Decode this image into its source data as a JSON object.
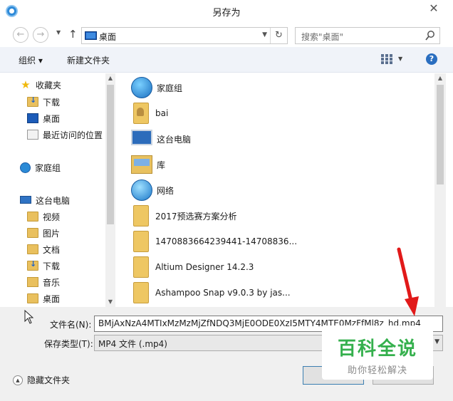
{
  "window": {
    "title": "另存为",
    "close": "✕"
  },
  "nav": {
    "back": "←",
    "forward": "→",
    "up": "↑",
    "address": "桌面",
    "search_placeholder": "搜索\"桌面\""
  },
  "toolbar": {
    "organize": "组织 ▾",
    "new_folder": "新建文件夹",
    "help": "?"
  },
  "sidebar": {
    "items": [
      {
        "label": "收藏夹",
        "icon": "star-icon"
      },
      {
        "label": "下载",
        "icon": "download-folder-icon"
      },
      {
        "label": "桌面",
        "icon": "desktop-icon"
      },
      {
        "label": "最近访问的位置",
        "icon": "recent-places-icon"
      },
      {
        "label": "家庭组",
        "icon": "homegroup-icon"
      },
      {
        "label": "这台电脑",
        "icon": "computer-icon"
      },
      {
        "label": "视频",
        "icon": "videos-folder-icon"
      },
      {
        "label": "图片",
        "icon": "pictures-folder-icon"
      },
      {
        "label": "文档",
        "icon": "documents-folder-icon"
      },
      {
        "label": "下载",
        "icon": "download-folder-icon"
      },
      {
        "label": "音乐",
        "icon": "music-folder-icon"
      },
      {
        "label": "桌面",
        "icon": "desktop-folder-icon"
      }
    ]
  },
  "files": [
    {
      "name": "家庭组",
      "icon": "homegroup-icon"
    },
    {
      "name": "bai",
      "icon": "user-folder-icon"
    },
    {
      "name": "这台电脑",
      "icon": "computer-icon"
    },
    {
      "name": "库",
      "icon": "libraries-icon"
    },
    {
      "name": "网络",
      "icon": "network-icon"
    },
    {
      "name": "2017预选赛方案分析",
      "icon": "folder-icon"
    },
    {
      "name": "1470883664239441-14708836...",
      "icon": "folder-icon"
    },
    {
      "name": "Altium Designer 14.2.3",
      "icon": "folder-icon"
    },
    {
      "name": "Ashampoo Snap v9.0.3 by jas...",
      "icon": "folder-icon"
    }
  ],
  "form": {
    "filename_label": "文件名(N):",
    "filename_value": "BMjAxNzA4MTIxMzMzMjZfNDQ3MjE0ODE0XzI5MTY4MTE0MzFfMl8z_hd.mp4",
    "filetype_label": "保存类型(T):",
    "filetype_value": "MP4 文件 (.mp4)",
    "hide_folders": "隐藏文件夹",
    "save_button": "保",
    "cancel_button": ""
  },
  "watermark": {
    "title": "百科全说",
    "subtitle": "助你轻松解决"
  },
  "colors": {
    "accent": "#2a6ec0",
    "watermark_green": "#35b04d",
    "annotation_red": "#e11919"
  }
}
